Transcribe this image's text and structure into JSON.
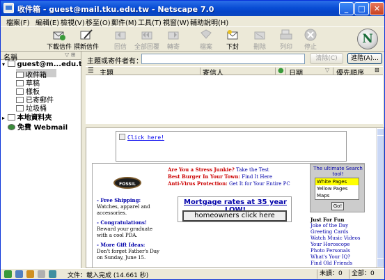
{
  "window": {
    "title": "收件箱 - guest@mail.tku.edu.tw - Netscape 7.0"
  },
  "menu": [
    "檔案(F)",
    "編輯(E)",
    "檢視(V)",
    "移至(O)",
    "郵件(M)",
    "工具(T)",
    "視窗(W)",
    "輔助說明(H)"
  ],
  "toolbar": [
    {
      "label": "下載信件",
      "icon": "get-mail-icon",
      "enabled": true
    },
    {
      "label": "撰新信件",
      "icon": "compose-icon",
      "enabled": true
    },
    {
      "label": "回信",
      "icon": "reply-icon",
      "enabled": false
    },
    {
      "label": "全部回覆",
      "icon": "reply-all-icon",
      "enabled": false
    },
    {
      "label": "轉寄",
      "icon": "forward-icon",
      "enabled": false
    },
    {
      "label": "檔案",
      "icon": "file-icon",
      "enabled": false
    },
    {
      "label": "下封",
      "icon": "next-icon",
      "enabled": true
    },
    {
      "label": "刪除",
      "icon": "delete-icon",
      "enabled": false
    },
    {
      "label": "列印",
      "icon": "print-icon",
      "enabled": false
    },
    {
      "label": "停止",
      "icon": "stop-icon",
      "enabled": false
    }
  ],
  "folders": {
    "header": "名稱",
    "account": "guest@m...edu.tw",
    "items": [
      {
        "label": "收件箱",
        "selected": true
      },
      {
        "label": "草稿",
        "selected": false
      },
      {
        "label": "樣板",
        "selected": false
      },
      {
        "label": "已寄郵件",
        "selected": false
      },
      {
        "label": "垃圾桶",
        "selected": false
      }
    ],
    "local": "本地資料夾",
    "webmail": "免費 Webmail"
  },
  "search": {
    "label": "主題或寄件者有：",
    "clear": "清除(C)",
    "advanced": "進階(A)..."
  },
  "columns": [
    "主題",
    "寄信人",
    "日期",
    "優先順序"
  ],
  "preview": {
    "click_here": "Click here!",
    "fossil_logo": "FOSSIL",
    "col1": [
      {
        "head": "- Free Shipping:",
        "body": "Watches, apparel and accessories."
      },
      {
        "head": "- Congratulations!",
        "body": "Reward your graduate with a cool PDA."
      },
      {
        "head": "- More Gift Ideas:",
        "body": "Don't forget Father's Day on Sunday, June 15."
      }
    ],
    "col2": [
      {
        "red": "Are You a Stress Junkie?",
        "blue": "Take the Test"
      },
      {
        "red": "Best Burger In Your Town:",
        "blue": "Find It Here"
      },
      {
        "red": "Anti-Virus Protection:",
        "blue": "Get It for Your Entire PC"
      }
    ],
    "mortgage_title": "Mortgage rates at 35 year LOW!",
    "mortgage_button": "homeowners click here",
    "search_tool_title": "The ultimate Search tool!",
    "search_options": [
      "White Pages",
      "Yellow Pages",
      "Maps"
    ],
    "go": "Go!",
    "fun_header": "Just For Fun",
    "fun_links": [
      "Joke of the Day",
      "Greeting Cards",
      "Watch Music Videos",
      "Your Horoscope",
      "Photo Personals",
      "What's Your IQ?",
      "Find Old Friends"
    ]
  },
  "status": {
    "text": "文件：載入完成 (14.661 秒)",
    "unread": "未讀：0",
    "total": "全部：0"
  }
}
